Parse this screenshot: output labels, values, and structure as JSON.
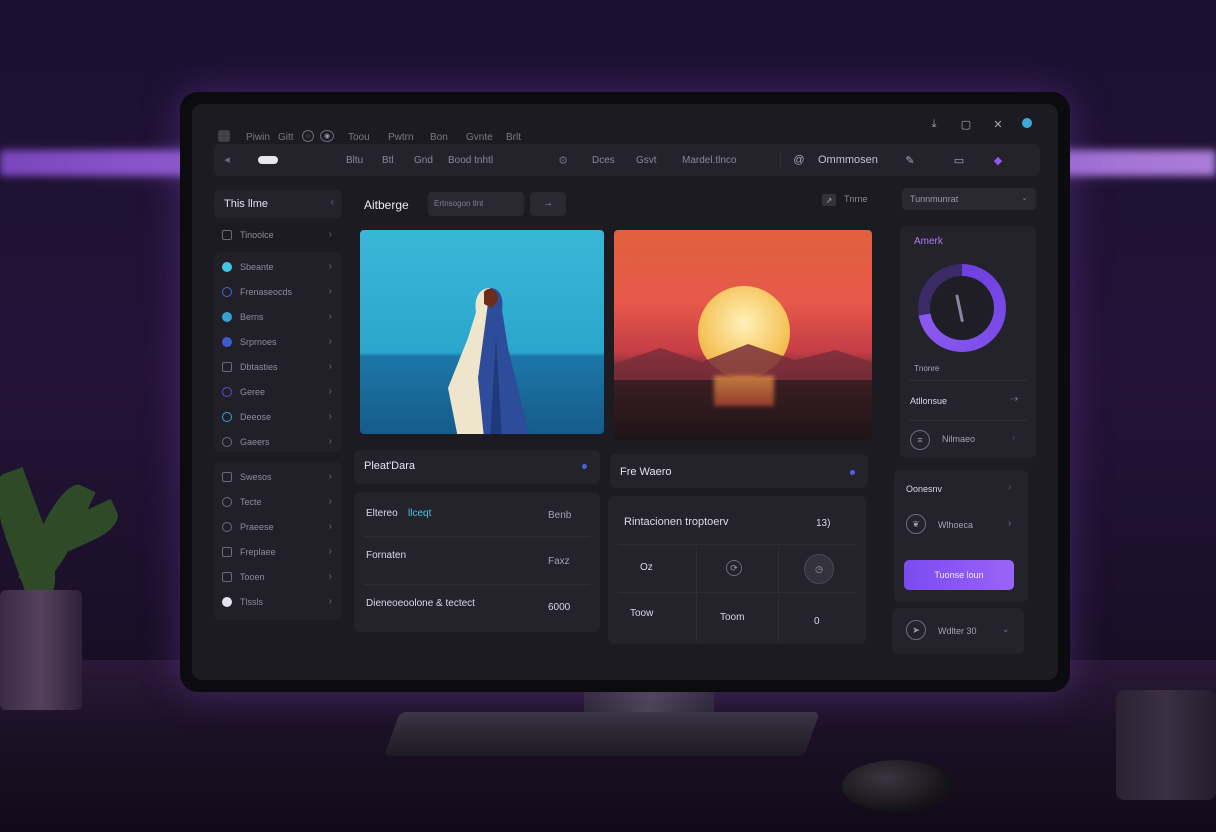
{
  "titlebar": {
    "items": [
      "Piwin",
      "Gitt",
      "Toou",
      "Pwtrn",
      "Bon",
      "Gvnte",
      "Brlt"
    ],
    "right_icons": [
      "download-icon",
      "box-icon",
      "network-icon",
      "status-dot-icon"
    ]
  },
  "navbar": {
    "items": [
      "Bltu",
      "Btl",
      "Gnd",
      "Bood tnhtl",
      "Dces",
      "Gsvt",
      "Mardel.tlnco"
    ],
    "search_label": "Ommmosen",
    "accent": "#8b5af0"
  },
  "sidebar": {
    "header": "This llme",
    "items_top": [
      {
        "label": "Tinoolce"
      }
    ],
    "items_group1": [
      {
        "label": "Sbeante"
      },
      {
        "label": "Frenaseocds"
      },
      {
        "label": "Berns"
      },
      {
        "label": "Srprnoes"
      },
      {
        "label": "Dbtasties"
      },
      {
        "label": "Geree"
      },
      {
        "label": "Deeose"
      },
      {
        "label": "Gaeers"
      }
    ],
    "items_group2": [
      {
        "label": "Swesos"
      },
      {
        "label": "Tecte"
      },
      {
        "label": "Praeese"
      },
      {
        "label": "Freplaee"
      },
      {
        "label": "Tooen"
      },
      {
        "label": "Tlssls"
      }
    ]
  },
  "main": {
    "title": "Aitberge",
    "filter_placeholder": "Ertnsogon tlnt",
    "filter_button": "→",
    "share_label": "Tnrne"
  },
  "cards": {
    "left_header": "Pleat'Dara",
    "right_header": "Fre Waero",
    "left_rows": [
      {
        "label_a": "Eltereo",
        "label_b": "llceqt",
        "value": "Benb"
      },
      {
        "label": "Fornaten",
        "value": "Faxz"
      },
      {
        "label": "Dieneoeoolone & tectect",
        "value": "6000"
      }
    ],
    "right_title": "Rintacionen troptoerv",
    "right_value": "13)",
    "right_grid": [
      "Oz",
      "Toow",
      "Toom",
      "0"
    ]
  },
  "right_panel": {
    "select": "Tunnmunrat",
    "gauge_title": "Amerk",
    "gauge_label": "Tnonre",
    "gauge_level_pct": 72,
    "row1": "Atllonsue",
    "row2": "Nilmaeo",
    "card2_title": "Oonesnv",
    "card2_row": "Wlhoeca",
    "cta": "Tuonse loun",
    "footer": "Wdlter 30"
  }
}
